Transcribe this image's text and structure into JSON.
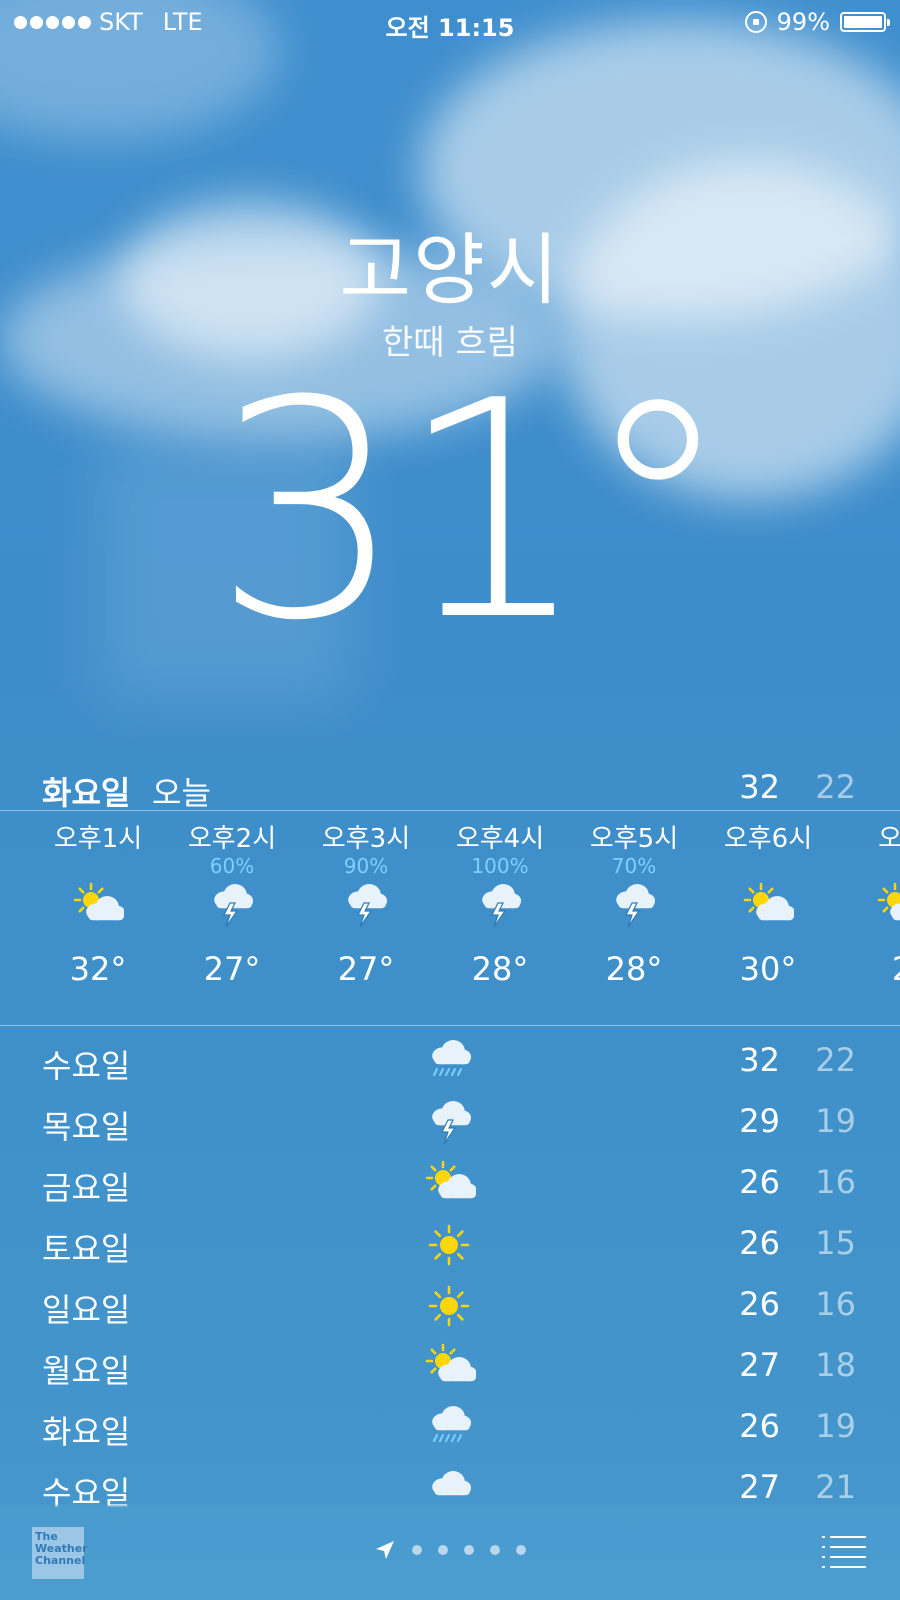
{
  "status_bar": {
    "carrier": "SKT",
    "network": "LTE",
    "time": "오전 11:15",
    "battery": "99%"
  },
  "header": {
    "city": "고양시",
    "condition": "한때 흐림",
    "temperature": "31°"
  },
  "today": {
    "day": "화요일",
    "label": "오늘",
    "high": "32",
    "low": "22"
  },
  "hourly": [
    {
      "time": "시",
      "precip": "",
      "icon": "partly-sunny-icon",
      "temp": ""
    },
    {
      "time": "오후1시",
      "precip": "",
      "icon": "partly-sunny-icon",
      "temp": "32°"
    },
    {
      "time": "오후2시",
      "precip": "60%",
      "icon": "thunderstorm-icon",
      "temp": "27°"
    },
    {
      "time": "오후3시",
      "precip": "90%",
      "icon": "thunderstorm-icon",
      "temp": "27°"
    },
    {
      "time": "오후4시",
      "precip": "100%",
      "icon": "thunderstorm-icon",
      "temp": "28°"
    },
    {
      "time": "오후5시",
      "precip": "70%",
      "icon": "thunderstorm-icon",
      "temp": "28°"
    },
    {
      "time": "오후6시",
      "precip": "",
      "icon": "partly-sunny-icon",
      "temp": "30°"
    },
    {
      "time": "오후",
      "precip": "",
      "icon": "partly-sunny-icon",
      "temp": "2"
    }
  ],
  "daily": [
    {
      "day": "수요일",
      "icon": "rain-icon",
      "high": "32",
      "low": "22"
    },
    {
      "day": "목요일",
      "icon": "thunderstorm-icon",
      "high": "29",
      "low": "19"
    },
    {
      "day": "금요일",
      "icon": "partly-sunny-icon",
      "high": "26",
      "low": "16"
    },
    {
      "day": "토요일",
      "icon": "sun-icon",
      "high": "26",
      "low": "15"
    },
    {
      "day": "일요일",
      "icon": "sun-icon",
      "high": "26",
      "low": "16"
    },
    {
      "day": "월요일",
      "icon": "partly-sunny-icon",
      "high": "27",
      "low": "18"
    },
    {
      "day": "화요일",
      "icon": "rain-icon",
      "high": "26",
      "low": "19"
    },
    {
      "day": "수요일",
      "icon": "cloud-icon",
      "high": "27",
      "low": "21"
    }
  ],
  "footer": {
    "logo_text": "The Weather Channel",
    "page_count": 5
  },
  "colors": {
    "sky": "#3f8fce",
    "precip": "#7fd0ff",
    "sun": "#ffd60a"
  }
}
